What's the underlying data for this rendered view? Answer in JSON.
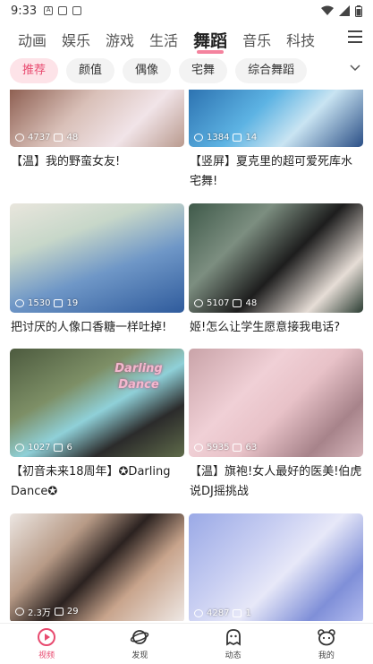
{
  "status_bar": {
    "time": "9:33"
  },
  "tabs": [
    {
      "label": "动画"
    },
    {
      "label": "娱乐"
    },
    {
      "label": "游戏"
    },
    {
      "label": "生活"
    },
    {
      "label": "舞蹈"
    },
    {
      "label": "音乐"
    },
    {
      "label": "科技"
    }
  ],
  "active_tab": "舞蹈",
  "chips": [
    {
      "label": "推荐"
    },
    {
      "label": "颜值"
    },
    {
      "label": "偶像"
    },
    {
      "label": "宅舞"
    },
    {
      "label": "综合舞蹈"
    }
  ],
  "feed": [
    {
      "views": "4737",
      "comments": "48",
      "title": "【温】我的野蛮女友!"
    },
    {
      "views": "1384",
      "comments": "14",
      "title": "【竖屏】夏克里的超可爱死库水宅舞!"
    },
    {
      "views": "1530",
      "comments": "19",
      "title": "把讨厌的人像口香糖一样吐掉!"
    },
    {
      "views": "5107",
      "comments": "48",
      "title": "姬!怎么让学生愿意接我电话?"
    },
    {
      "views": "1027",
      "comments": "6",
      "title": "【初音未来18周年】✪Darling Dance✪",
      "overlay": "Darling Dance"
    },
    {
      "views": "5935",
      "comments": "63",
      "title": "【温】旗袍!女人最好的医美!伯虎说DJ摇挑战"
    },
    {
      "views": "2.3万",
      "comments": "29",
      "title": ""
    },
    {
      "views": "4287",
      "comments": "1",
      "title": ""
    }
  ],
  "bottom_nav": [
    {
      "label": "视频",
      "icon": "video-icon"
    },
    {
      "label": "发现",
      "icon": "planet-icon"
    },
    {
      "label": "动态",
      "icon": "ghost-icon"
    },
    {
      "label": "我的",
      "icon": "bear-face-icon"
    }
  ],
  "colors": {
    "accent": "#e84a6f",
    "chip_active_bg": "#fde3e8",
    "chip_bg": "#f3f3f3"
  }
}
